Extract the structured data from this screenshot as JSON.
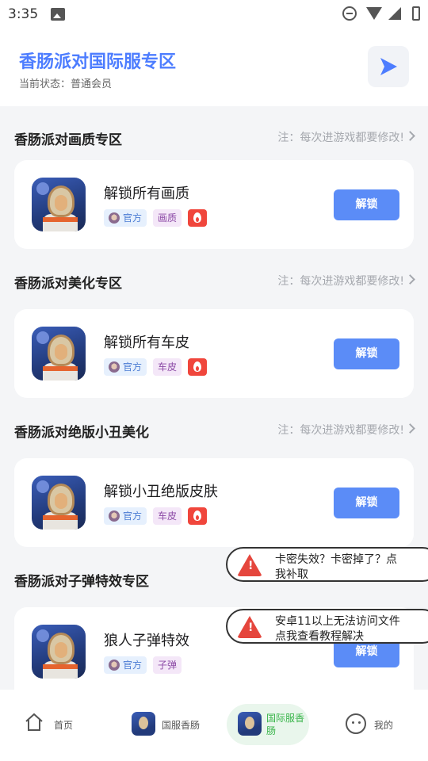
{
  "status_bar": {
    "time": "3:35"
  },
  "header": {
    "title": "香肠派对国际服专区",
    "subtitle": "当前状态：普通会员"
  },
  "sections": [
    {
      "title": "香肠派对画质专区",
      "note": "注：每次进游戏都要修改!",
      "card": {
        "name": "解锁所有画质",
        "tags": [
          "官方",
          "画质"
        ],
        "hot": true,
        "button": "解锁"
      }
    },
    {
      "title": "香肠派对美化专区",
      "note": "注：每次进游戏都要修改!",
      "card": {
        "name": "解锁所有车皮",
        "tags": [
          "官方",
          "车皮"
        ],
        "hot": true,
        "button": "解锁"
      }
    },
    {
      "title": "香肠派对绝版小丑美化",
      "note": "注：每次进游戏都要修改!",
      "card": {
        "name": "解锁小丑绝版皮肤",
        "tags": [
          "官方",
          "车皮"
        ],
        "hot": true,
        "button": "解锁"
      }
    },
    {
      "title": "香肠派对子弹特效专区",
      "note": "",
      "card": {
        "name": "狼人子弹特效",
        "tags": [
          "官方",
          "子弹"
        ],
        "hot": false,
        "button": "解锁"
      }
    }
  ],
  "toasts": [
    {
      "line1": "卡密失效？卡密掉了？点",
      "line2": "我补取"
    },
    {
      "line1": "安卓11以上无法访问文件",
      "line2": "点我查看教程解决"
    }
  ],
  "bottom_nav": [
    {
      "label": "首页",
      "icon": "home-icon",
      "active": false
    },
    {
      "label": "国服香肠",
      "icon": "game-avatar-icon",
      "active": false
    },
    {
      "label": "国际服香肠",
      "icon": "game-avatar-icon",
      "active": true
    },
    {
      "label": "我的",
      "icon": "profile-icon",
      "active": false
    }
  ],
  "colors": {
    "accent": "#4d7dff",
    "button": "#5b8cf7",
    "active_nav": "#39b54a",
    "hot": "#f0463c"
  }
}
